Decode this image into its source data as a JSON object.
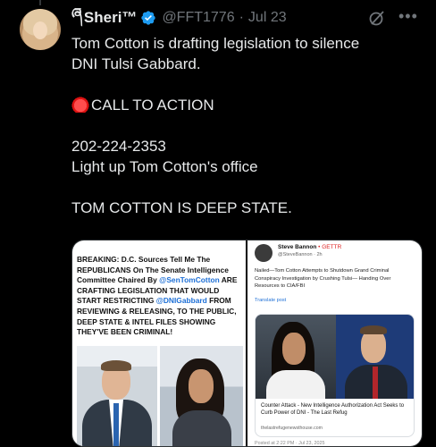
{
  "author": {
    "display_name": "Sheri™",
    "logo_glyph": "ཞ",
    "handle": "@FFT1776",
    "separator": "·",
    "date": "Jul 23"
  },
  "icons": {
    "verified": "verified-badge-icon",
    "grok": "grok-icon",
    "more": "more-options-icon",
    "alarm": "police-light-emoji"
  },
  "colors": {
    "background": "#000000",
    "text": "#e7e9ea",
    "muted": "#71767b",
    "verified": "#1d9bf0"
  },
  "more_glyph": "•••",
  "tweet": {
    "line1": "Tom Cotton is drafting legislation to silence",
    "line2": "DNI Tulsi Gabbard.",
    "call_to_action": "CALL TO ACTION",
    "phone": "202-224-2353",
    "line5": "Light up Tom Cotton's office",
    "line6": "TOM COTTON IS DEEP STATE."
  },
  "media": {
    "left_card": {
      "part1": "BREAKING: D.C. Sources Tell Me The REPUBLICANS On The Senate Intelligence Committee Chaired By ",
      "mention1": "@SenTomCotton",
      "part2": " ARE CRAFTING LEGISLATION THAT WOULD START RESTRICTING ",
      "mention2": "@DNIGabbard",
      "part3": " FROM REVIEWING & RELEASING, TO THE PUBLIC, DEEP STATE & INTEL FILES SHOWING THEY'VE BEEN CRIMINAL!"
    },
    "right_card": {
      "name": "Steve Bannon",
      "flag": "• GETTR",
      "handle": "@SteveBannon · 2h",
      "body": "Nailed—Tom Cotton Attempts to Shutdown Grand Criminal Conspiracy Investigation by Crushing Tulsi— Handing Over Resources to CIA/FBI",
      "translate": "Translate post",
      "caption": "Counter Attack - New Intelligence Authorization Act Seeks to Curb Power of DNI - The Last Refug",
      "domain": "thelastrefugenewsthouse.com",
      "timestamp": "Posted at 2:22 PM · Jul 23, 2025"
    }
  }
}
